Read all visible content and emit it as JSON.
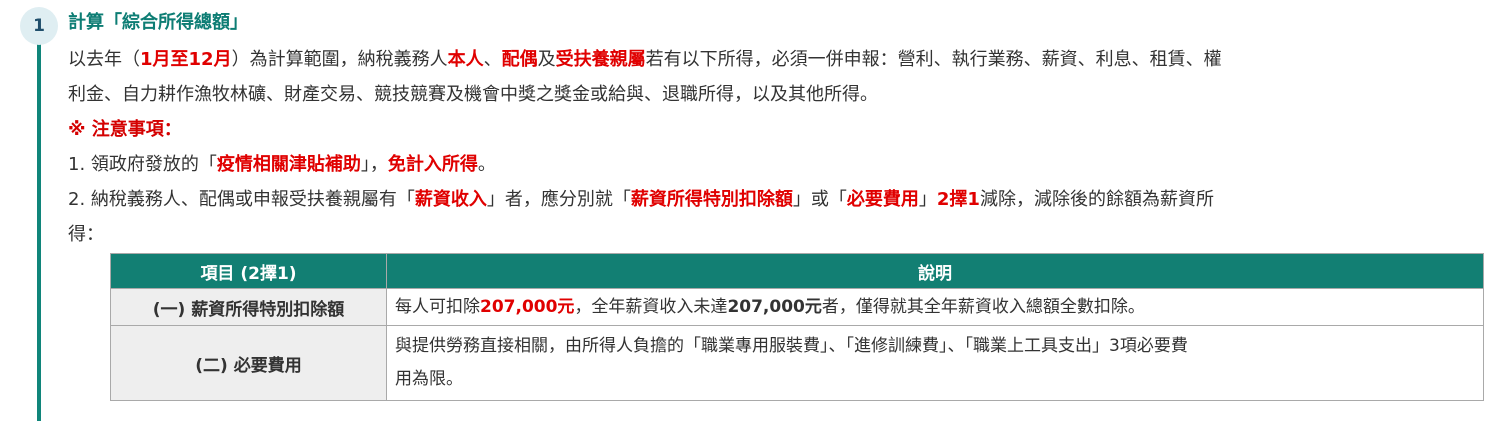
{
  "step": {
    "number": "1",
    "title": "計算「綜合所得總額」"
  },
  "intro": {
    "line1_a": "以去年（",
    "line1_period": "1月至12月",
    "line1_b": "）為計算範圍，納稅義務人",
    "line1_self": "本人",
    "line1_sep": "、",
    "line1_spouse": "配偶",
    "line1_and": "及",
    "line1_dependents": "受扶養親屬",
    "line1_c": "若有以下所得，必須一併申報：營利、執行業務、薪資、利息、租賃、權",
    "line2": "利金、自力耕作漁牧林礦、財產交易、競技競賽及機會中獎之獎金或給與、退職所得，以及其他所得。"
  },
  "notes": {
    "title": "※ 注意事項：",
    "item1_a": "1. 領政府發放的「",
    "item1_red": "疫情相關津貼補助",
    "item1_b": "」，",
    "item1_red2": "免計入所得",
    "item1_c": "。",
    "item2_a": "2. 納稅義務人、配偶或申報受扶養親屬有「",
    "item2_red1": "薪資收入",
    "item2_b": "」者，應分別就「",
    "item2_red2": "薪資所得特別扣除額",
    "item2_c": "」或「",
    "item2_red3": "必要費用",
    "item2_d": "」",
    "item2_red4": "2擇1",
    "item2_e": "減除，減除後的餘額為薪資所",
    "item2_line2": "得："
  },
  "table": {
    "headers": [
      "項目 (2擇1)",
      "說明"
    ],
    "row1": {
      "label": "(一) 薪資所得特別扣除額",
      "desc_a": "每人可扣除",
      "desc_amount_red": "207,000元",
      "desc_b": "，全年薪資收入未達",
      "desc_amount_bold": "207,000元",
      "desc_c": "者，僅得就其全年薪資收入總額全數扣除。"
    },
    "row2": {
      "label": "(二) 必要費用",
      "desc_line1": "與提供勞務直接相關，由所得人負擔的「職業專用服裝費」、「進修訓練費」、「職業上工具支出」3項必要費",
      "desc_line2": "用為限。"
    }
  },
  "colors": {
    "accent_teal": "#127f73",
    "emphasis_red": "#e00000",
    "badge_bg": "#dfeef2"
  }
}
